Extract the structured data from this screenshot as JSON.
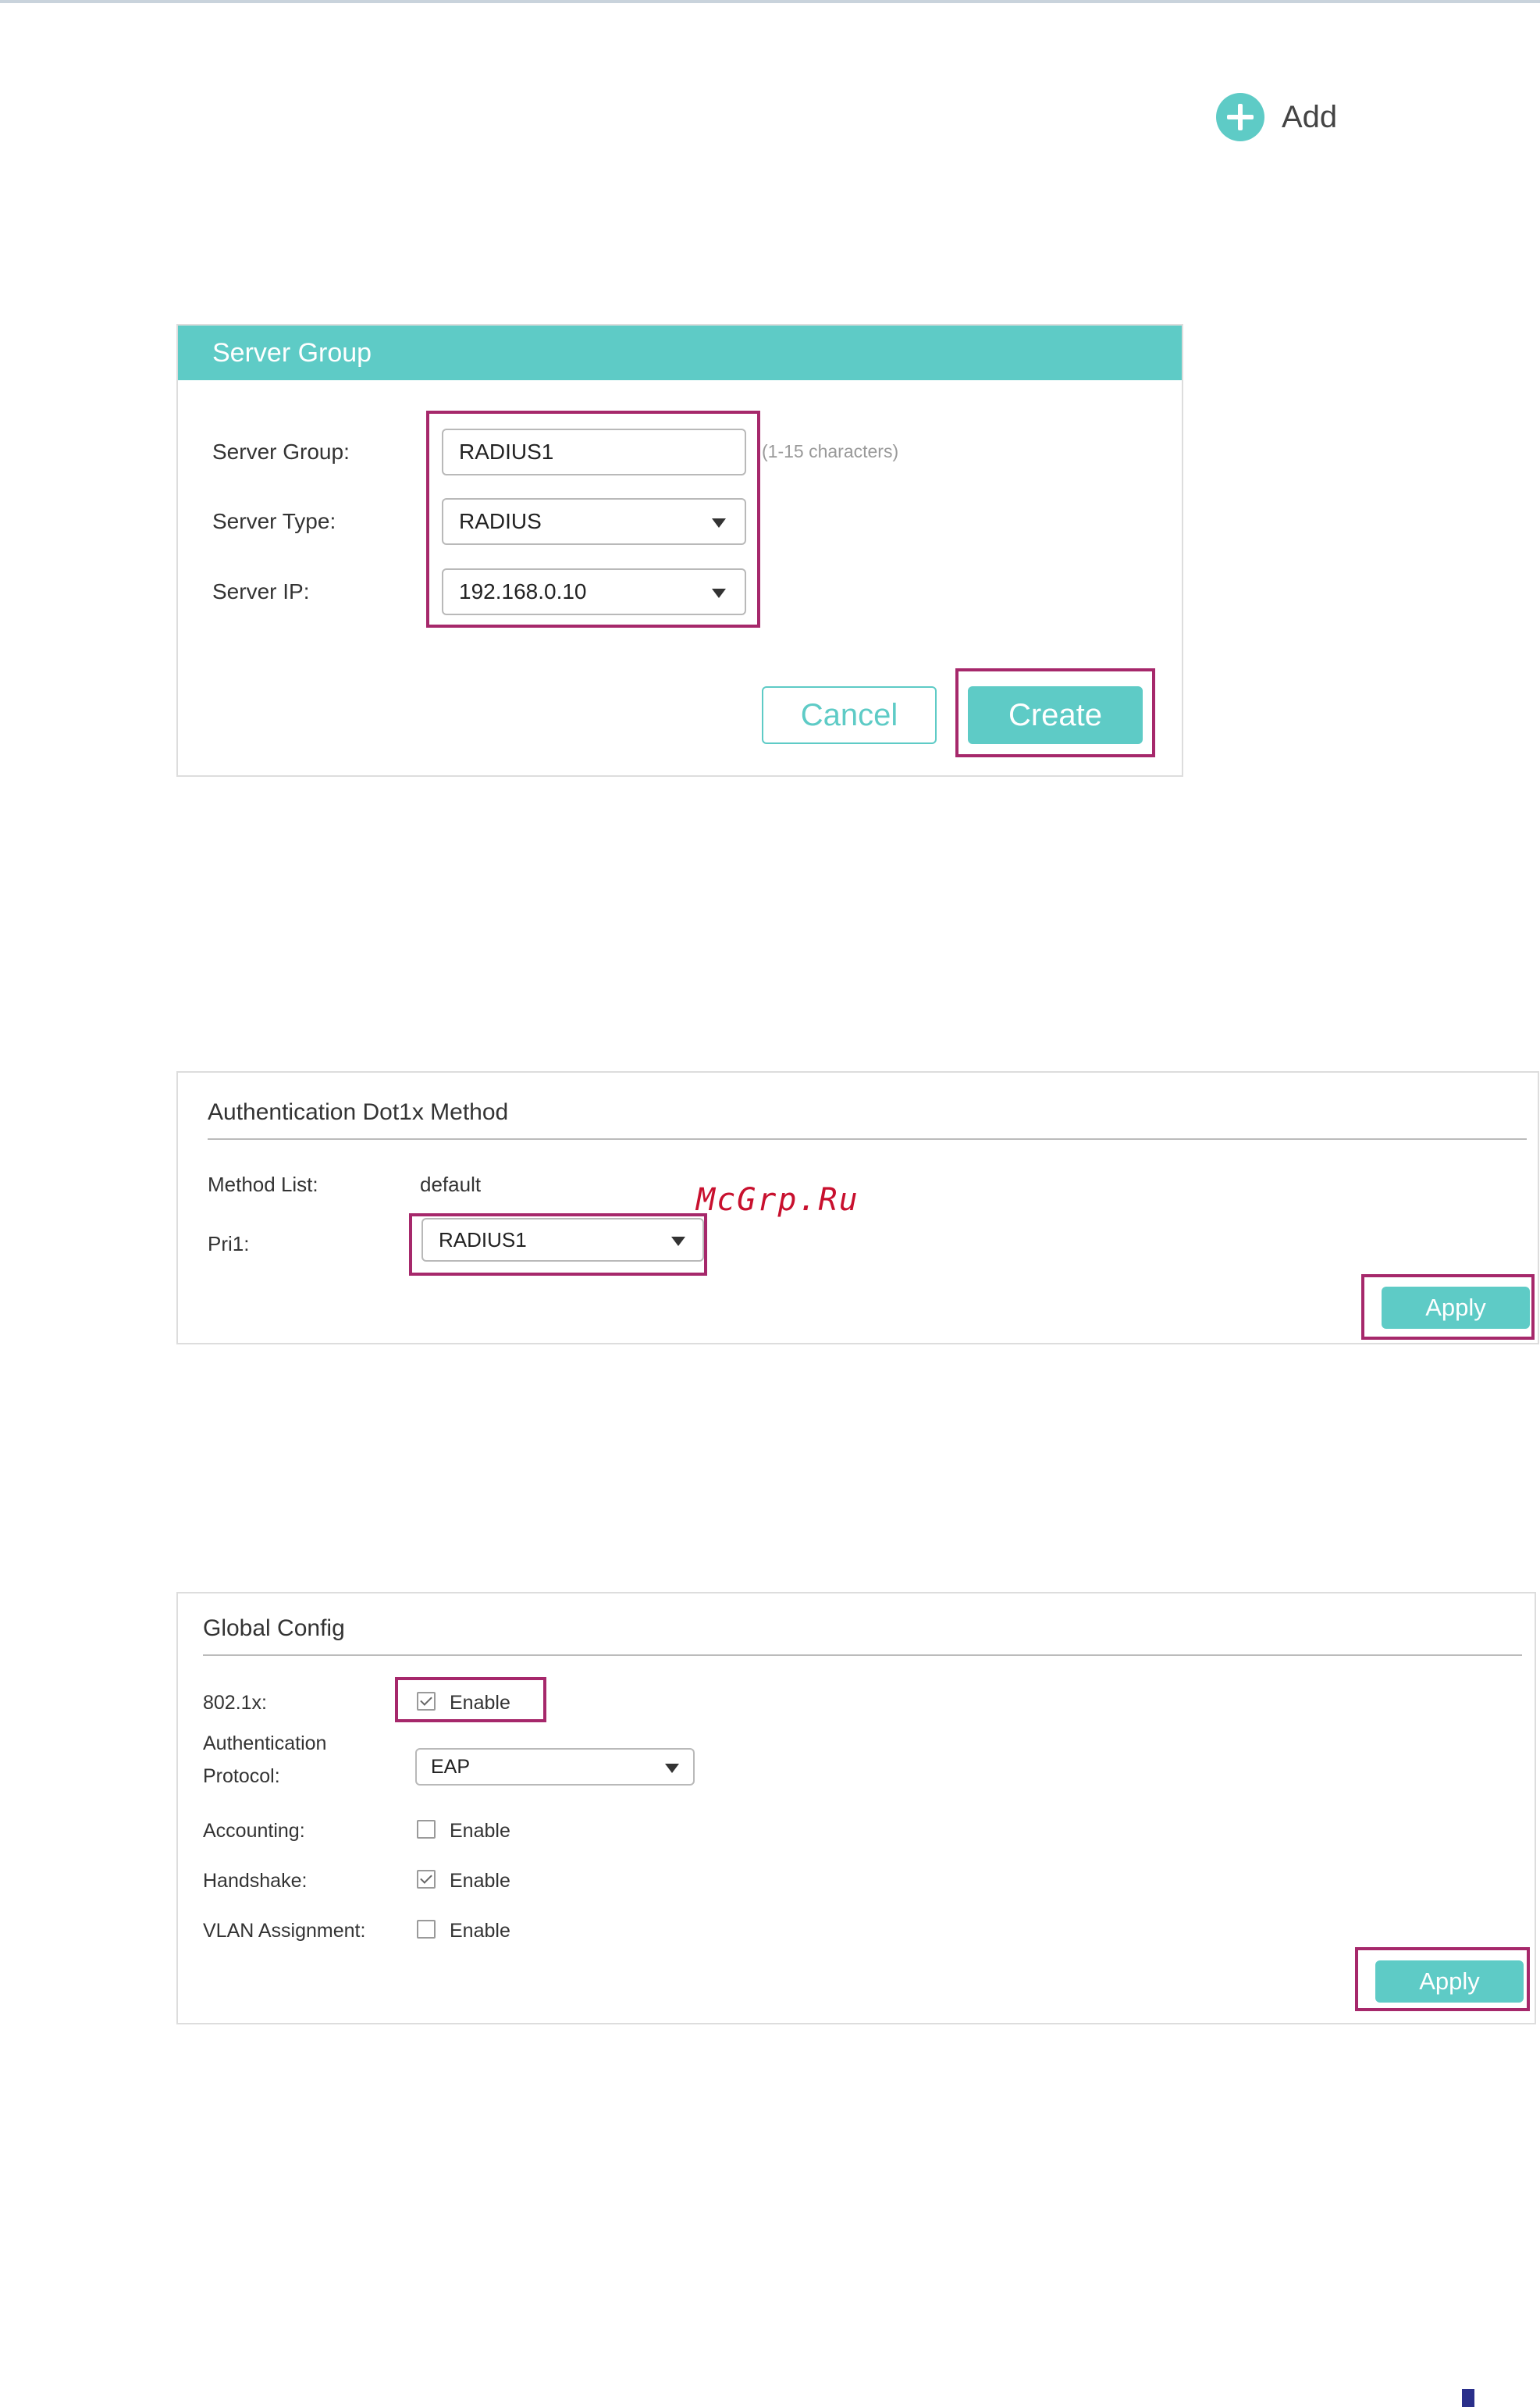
{
  "add": {
    "label": "Add",
    "icon": "plus-circle-icon"
  },
  "server_group": {
    "title": "Server Group",
    "group_label": "Server Group:",
    "group_value": "RADIUS1",
    "group_hint": "(1-15 characters)",
    "type_label": "Server Type:",
    "type_value": "RADIUS",
    "ip_label": "Server IP:",
    "ip_value": "192.168.0.10",
    "cancel_label": "Cancel",
    "create_label": "Create"
  },
  "dot1x": {
    "title": "Authentication Dot1x Method",
    "method_list_label": "Method List:",
    "method_list_value": "default",
    "pri1_label": "Pri1:",
    "pri1_value": "RADIUS1",
    "apply_label": "Apply"
  },
  "global_config": {
    "title": "Global Config",
    "dot1x_label": "802.1x:",
    "dot1x_enable_label": "Enable",
    "dot1x_checked": true,
    "auth_protocol_label_1": "Authentication",
    "auth_protocol_label_2": "Protocol:",
    "auth_protocol_value": "EAP",
    "accounting_label": "Accounting:",
    "accounting_enable_label": "Enable",
    "accounting_checked": false,
    "handshake_label": "Handshake:",
    "handshake_enable_label": "Enable",
    "handshake_checked": true,
    "vlan_label": "VLAN Assignment:",
    "vlan_enable_label": "Enable",
    "vlan_checked": false,
    "apply_label": "Apply"
  },
  "watermark": "McGrp.Ru",
  "colors": {
    "accent": "#5ecbc6",
    "highlight": "#a6286b",
    "watermark": "#c8102e"
  }
}
